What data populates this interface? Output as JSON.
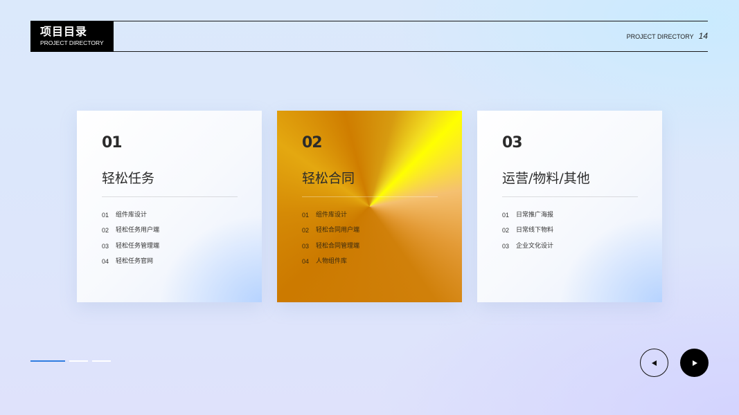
{
  "header": {
    "title": "项目目录",
    "subtitle": "PROJECT DIRECTORY",
    "right_label": "PROJECT DIRECTORY",
    "page_number": "14"
  },
  "cards": [
    {
      "number": "01",
      "title": "轻松任务",
      "items": [
        {
          "index": "01",
          "label": "组件库设计"
        },
        {
          "index": "02",
          "label": "轻松任务用户端"
        },
        {
          "index": "03",
          "label": "轻松任务管理端"
        },
        {
          "index": "04",
          "label": "轻松任务官网"
        }
      ]
    },
    {
      "number": "02",
      "title": "轻松合同",
      "items": [
        {
          "index": "01",
          "label": "组件库设计"
        },
        {
          "index": "02",
          "label": "轻松合同用户端"
        },
        {
          "index": "03",
          "label": "轻松合同管理端"
        },
        {
          "index": "04",
          "label": "人物组件库"
        }
      ]
    },
    {
      "number": "03",
      "title": "运营/物料/其他",
      "items": [
        {
          "index": "01",
          "label": "日常推广海报"
        },
        {
          "index": "02",
          "label": "日常线下物料"
        },
        {
          "index": "03",
          "label": "企业文化设计"
        }
      ]
    }
  ],
  "progress": {
    "total": 3,
    "active_index": 0
  },
  "nav": {
    "prev_icon": "triangle-left-icon",
    "next_icon": "triangle-right-icon"
  },
  "colors": {
    "accent": "#2f7de0",
    "gold": "#cc7a00",
    "black": "#000000"
  }
}
